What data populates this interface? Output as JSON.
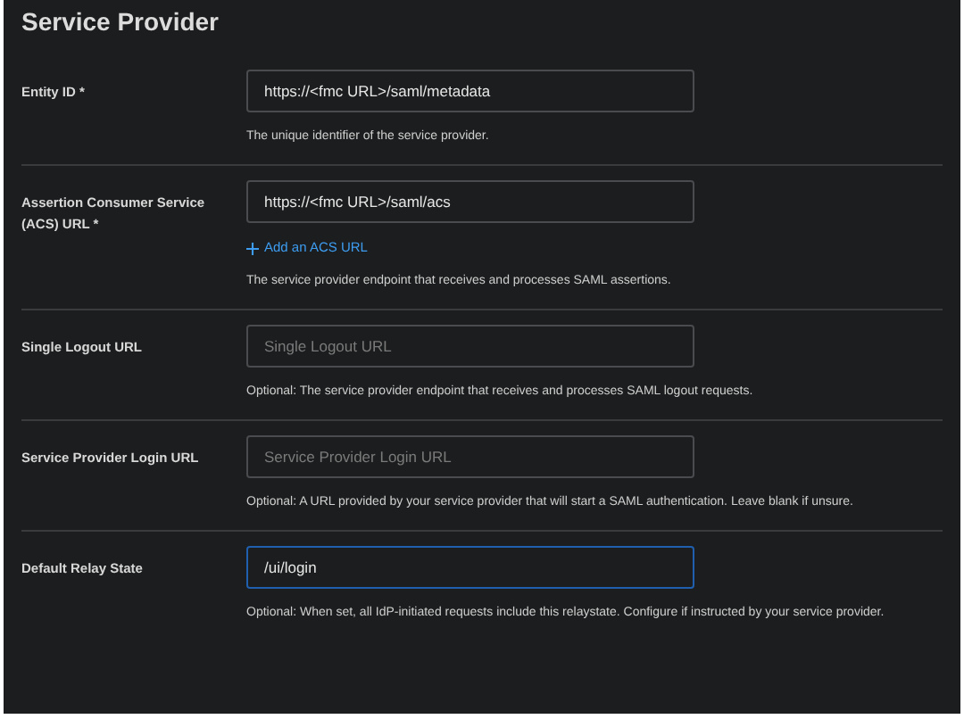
{
  "title": "Service Provider",
  "fields": [
    {
      "label": "Entity ID *",
      "value": "https://<fmc URL>/saml/metadata",
      "focused": false,
      "help": "The unique identifier of the service provider."
    },
    {
      "label": "Assertion Consumer Service (ACS) URL *",
      "value": "https://<fmc URL>/saml/acs",
      "focused": false,
      "add_link": "Add an ACS URL",
      "help": "The service provider endpoint that receives and processes SAML assertions."
    },
    {
      "label": "Single Logout URL",
      "placeholder": "Single Logout URL",
      "focused": false,
      "help": "Optional: The service provider endpoint that receives and processes SAML logout requests."
    },
    {
      "label": "Service Provider Login URL",
      "placeholder": "Service Provider Login URL",
      "focused": false,
      "help": "Optional: A URL provided by your service provider that will start a SAML authentication. Leave blank if unsure."
    },
    {
      "label": "Default Relay State",
      "value": "/ui/login",
      "focused": true,
      "help": "Optional: When set, all IdP-initiated requests include this relaystate. Configure if instructed by your service provider."
    }
  ]
}
